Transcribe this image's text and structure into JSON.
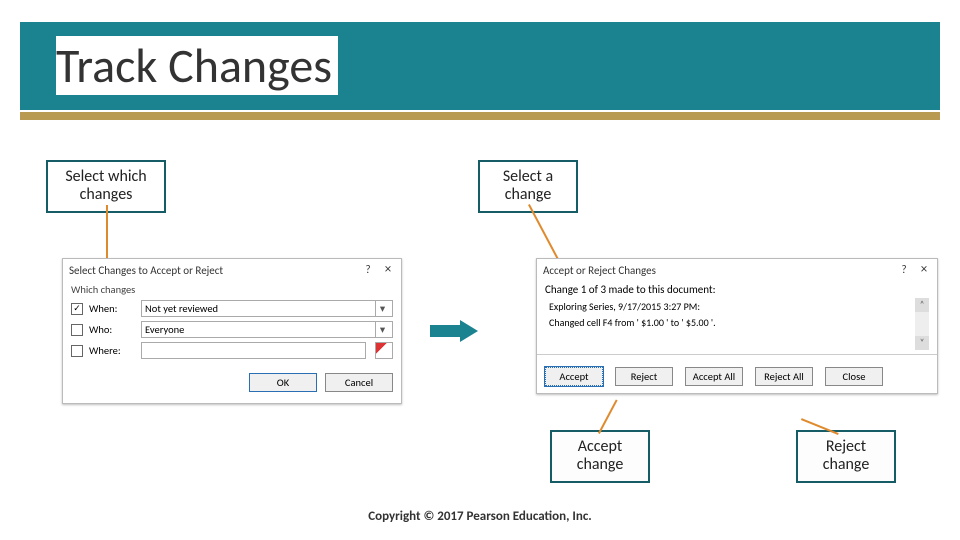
{
  "slide": {
    "title": "Track Changes",
    "copyright": "Copyright © 2017 Pearson Education, Inc."
  },
  "callouts": {
    "select_which": "Select which changes",
    "select_a": "Select a change",
    "accept": "Accept change",
    "reject": "Reject change"
  },
  "dialog1": {
    "title": "Select Changes to Accept or Reject",
    "help": "?",
    "close": "×",
    "group": "Which changes",
    "rows": {
      "when": {
        "checked": true,
        "label": "When:",
        "value": "Not yet reviewed"
      },
      "who": {
        "checked": false,
        "label": "Who:",
        "value": "Everyone"
      },
      "where": {
        "checked": false,
        "label": "Where:",
        "value": ""
      }
    },
    "buttons": {
      "ok": "OK",
      "cancel": "Cancel"
    }
  },
  "dialog2": {
    "title": "Accept or Reject Changes",
    "help": "?",
    "close": "×",
    "summary": "Change 1 of 3 made to this document:",
    "author_line": "Exploring Series, 9/17/2015 3:27 PM:",
    "detail": "Changed cell F4 from ' $1.00 ' to ' $5.00 '.",
    "buttons": {
      "accept": "Accept",
      "reject": "Reject",
      "accept_all": "Accept All",
      "reject_all": "Reject All",
      "close": "Close"
    },
    "scroll_up": "˄",
    "scroll_down": "˅"
  }
}
